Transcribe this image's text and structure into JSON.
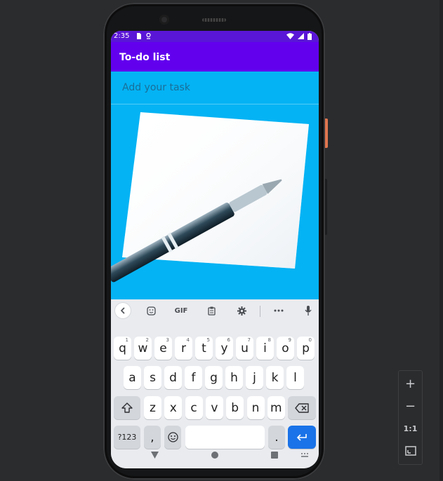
{
  "status_bar": {
    "time": "2:35"
  },
  "app_bar": {
    "title": "To-do list"
  },
  "task_input": {
    "placeholder": "Add your task",
    "value": ""
  },
  "illustration": {
    "description_icon": "paper-and-pen-icon"
  },
  "keyboard": {
    "toolbar": [
      "back-icon",
      "sticker-icon",
      "GIF",
      "clipboard-icon",
      "settings-icon",
      "more-icon",
      "mic-icon"
    ],
    "toolbar_gif": "GIF",
    "row1": [
      {
        "k": "q",
        "n": "1"
      },
      {
        "k": "w",
        "n": "2"
      },
      {
        "k": "e",
        "n": "3"
      },
      {
        "k": "r",
        "n": "4"
      },
      {
        "k": "t",
        "n": "5"
      },
      {
        "k": "y",
        "n": "6"
      },
      {
        "k": "u",
        "n": "7"
      },
      {
        "k": "i",
        "n": "8"
      },
      {
        "k": "o",
        "n": "9"
      },
      {
        "k": "p",
        "n": "0"
      }
    ],
    "row2": [
      "a",
      "s",
      "d",
      "f",
      "g",
      "h",
      "j",
      "k",
      "l"
    ],
    "row3": [
      "z",
      "x",
      "c",
      "v",
      "b",
      "n",
      "m"
    ],
    "row4": {
      "symbols": "?123",
      "comma": ",",
      "period": "."
    },
    "icons": {
      "shift": "shift-icon",
      "backspace": "backspace-icon",
      "emoji": "emoji-icon",
      "enter": "enter-icon"
    }
  },
  "nav_bar": {
    "back": "back-triangle-icon",
    "home": "home-circle-icon",
    "recents": "recents-square-icon"
  },
  "emulator": {
    "zoom_in": "+",
    "zoom_out": "−",
    "actual_size": "1:1",
    "fit": "fit-screen-icon"
  },
  "colors": {
    "primary": "#6200ee",
    "status_bar": "#5a16d6",
    "content_bg": "#04b3f4",
    "enter_key": "#1a73e8"
  }
}
